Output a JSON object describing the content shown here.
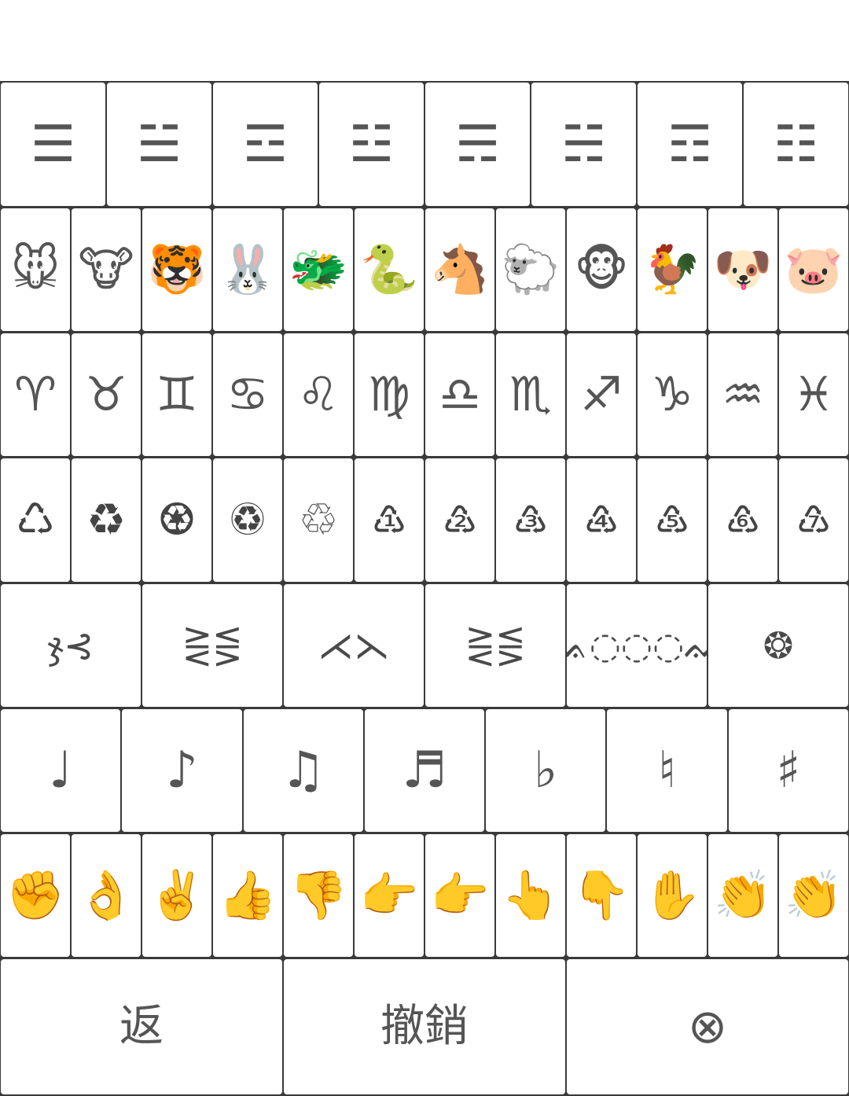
{
  "trigrams": [
    "☰",
    "☱",
    "☲",
    "☳",
    "☴",
    "☵",
    "☶",
    "☷"
  ],
  "zodiac_animals": [
    "🐭",
    "🐮",
    "🐯",
    "🐰",
    "🐲",
    "🐍",
    "🐴",
    "🐑",
    "🐵",
    "🐓",
    "🐶",
    "🐷"
  ],
  "zodiac_signs": [
    "♈",
    "♉",
    "♊",
    "♋",
    "♌",
    "♍",
    "♎",
    "♏",
    "♐",
    "♑",
    "♒",
    "♓"
  ],
  "recycle_symbols": [
    "♲",
    "♻",
    "♼",
    "♽",
    "♳",
    "♴",
    "♵",
    "♶",
    "♷",
    "♸",
    "♹"
  ],
  "recycle_first": "♺",
  "decorations": [
    "ჯ⊰",
    "⋛⋚",
    "⋌⋋",
    "⋛⋚",
    "ᨐ◌◌◌ᨐ",
    "❂"
  ],
  "music_symbols": [
    "♩",
    "♪",
    "♫",
    "♬",
    "♭",
    "♮",
    "♯"
  ],
  "hand_emojis": [
    "✊",
    "👌",
    "✌️",
    "👍",
    "👎",
    "👉",
    "👉",
    "👆",
    "👇",
    "✋",
    "👏",
    "👏"
  ],
  "actions": {
    "back_label": "返",
    "undo_label": "撤銷",
    "delete_label": "⊗"
  }
}
